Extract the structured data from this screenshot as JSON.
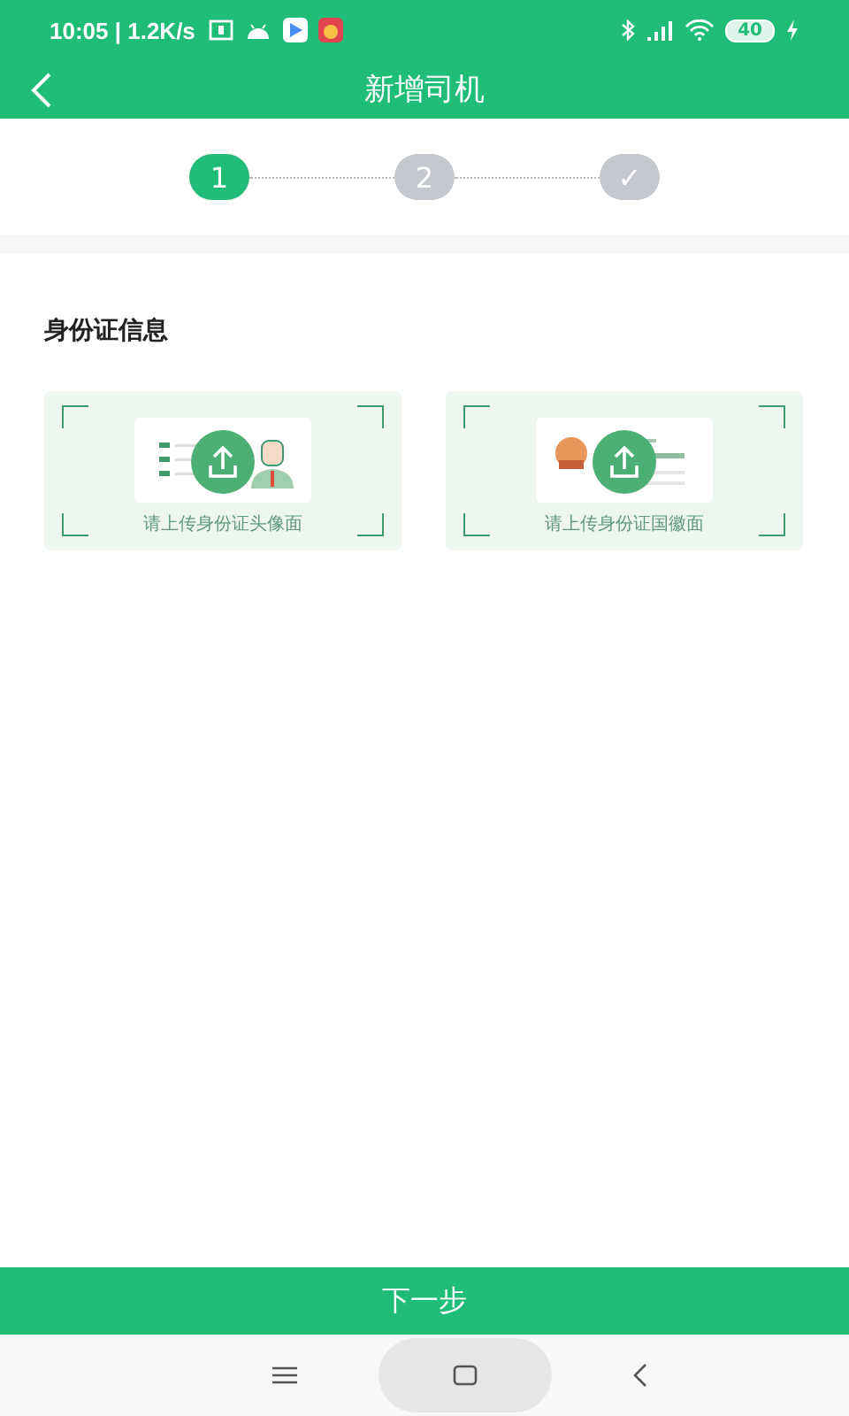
{
  "status_bar": {
    "time": "10:05 | 1.2K/s",
    "battery": "40"
  },
  "header": {
    "title": "新增司机"
  },
  "steps": [
    {
      "label": "1",
      "selected": true
    },
    {
      "label": "2",
      "selected": false
    },
    {
      "label": "✓",
      "selected": false
    }
  ],
  "section_title": "身份证信息",
  "uploads": [
    {
      "kind": "portrait",
      "caption": "请上传身份证头像面"
    },
    {
      "kind": "emblem",
      "caption": "请上传身份证国徽面"
    }
  ],
  "next_button": "下一步"
}
